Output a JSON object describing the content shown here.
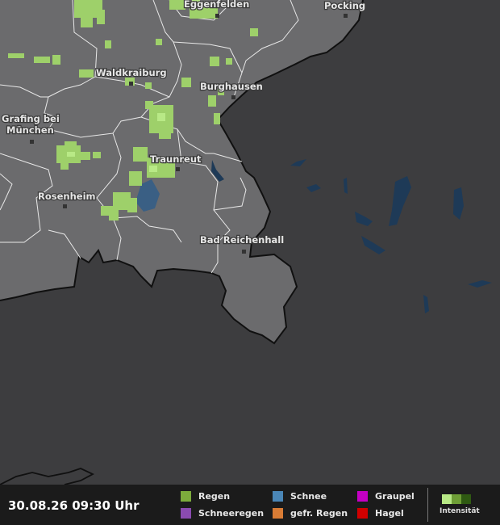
{
  "map": {
    "cities": [
      "Eggenfelden",
      "Pocking",
      "Waldkraiburg",
      "Burghausen",
      "Grafing bei",
      "München",
      "Traunreut",
      "Rosenheim",
      "Bad Reichenhall"
    ]
  },
  "footer": {
    "timestamp": "30.08.26 09:30 Uhr",
    "legend": [
      {
        "label": "Regen",
        "color": "#7cab3c"
      },
      {
        "label": "Schneeregen",
        "color": "#8a4bb0"
      },
      {
        "label": "Schnee",
        "color": "#4a86b6"
      },
      {
        "label": "gefr. Regen",
        "color": "#d97c35"
      },
      {
        "label": "Graupel",
        "color": "#c400c4"
      },
      {
        "label": "Hagel",
        "color": "#d10000"
      }
    ],
    "intensity_label": "Intensität",
    "intensity_colors": [
      "#b8e986",
      "#6e9e36",
      "#2f5a12"
    ]
  }
}
